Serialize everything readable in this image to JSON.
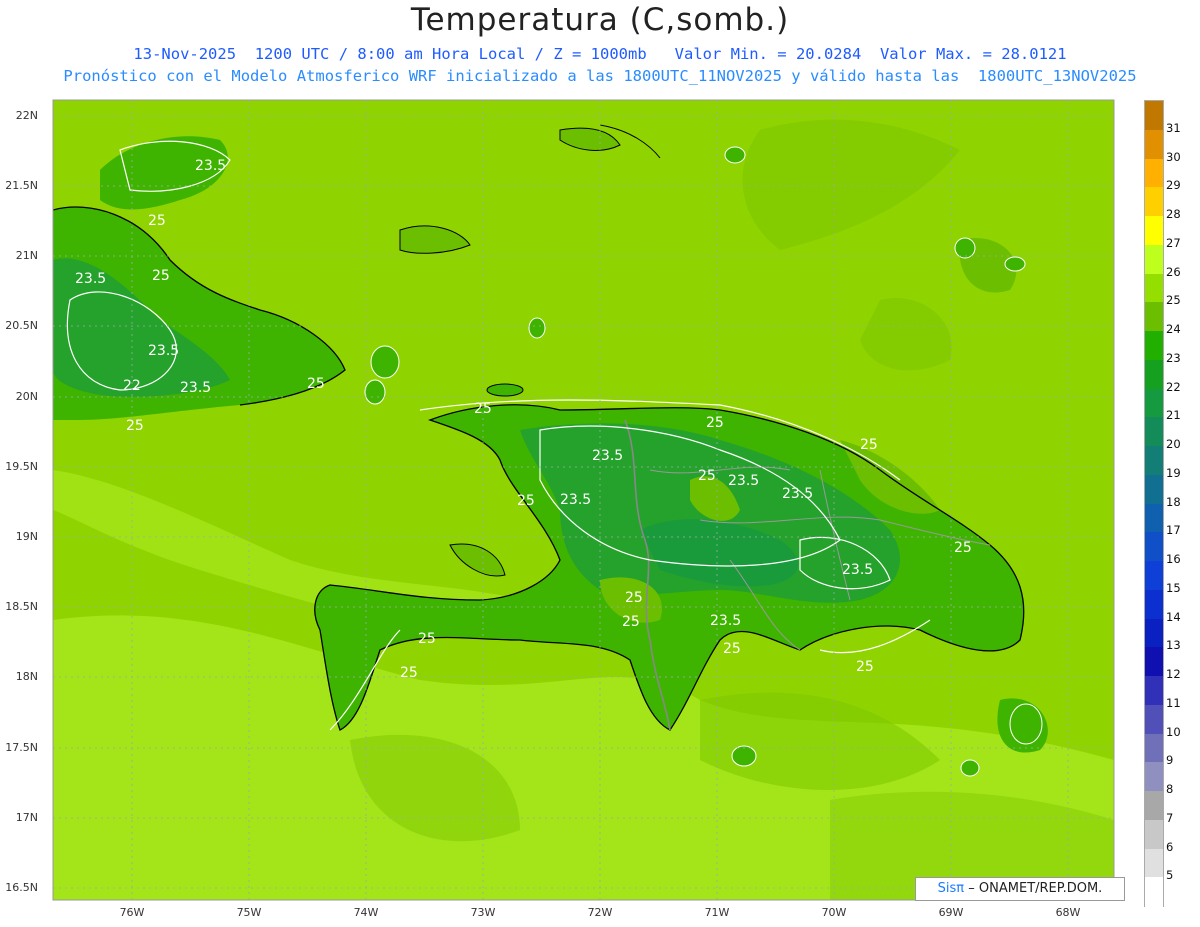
{
  "header": {
    "title": "Temperatura (C,somb.)",
    "line1": "13-Nov-2025  1200 UTC / 8:00 am Hora Local / Z = 1000mb   Valor Min. = 20.0284  Valor Max. = 28.0121",
    "line2": "Pronóstico con el Modelo Atmosferico WRF inicializado a las 1800UTC_11NOV2025 y válido hasta las  1800UTC_13NOV2025"
  },
  "axes": {
    "lat_labels": [
      "22N",
      "21.5N",
      "21N",
      "20.5N",
      "20N",
      "19.5N",
      "19N",
      "18.5N",
      "18N",
      "17.5N",
      "17N",
      "16.5N"
    ],
    "lon_labels": [
      "76W",
      "75W",
      "74W",
      "73W",
      "72W",
      "71W",
      "70W",
      "69W",
      "68W"
    ]
  },
  "contour_labels": [
    "23.5",
    "25",
    "23.5",
    "25",
    "23.5",
    "22",
    "23.5",
    "25",
    "25",
    "25",
    "25",
    "23.5",
    "23.5",
    "25",
    "23.5",
    "23.5",
    "25",
    "25",
    "23.5",
    "25",
    "25",
    "25",
    "25",
    "25",
    "23.5",
    "25"
  ],
  "colorbar": {
    "labels": [
      "31",
      "30",
      "29",
      "28",
      "27",
      "26",
      "25",
      "24",
      "23",
      "22",
      "21",
      "20",
      "19",
      "18",
      "17",
      "16",
      "15",
      "14",
      "13",
      "12",
      "11",
      "10",
      "9",
      "8",
      "7",
      "6",
      "5"
    ],
    "colors": [
      "#c07800",
      "#e09000",
      "#ffb000",
      "#ffd000",
      "#ffff00",
      "#bfff1e",
      "#95df00",
      "#6cbf00",
      "#22b000",
      "#15a020",
      "#169a40",
      "#148c5a",
      "#127e76",
      "#117092",
      "#1060b0",
      "#0f50c8",
      "#0e40d8",
      "#0c30d0",
      "#0a20c0",
      "#1010b0",
      "#3030b8",
      "#5050b8",
      "#7070b8",
      "#9090c0",
      "#a8a8a8",
      "#c8c8c8",
      "#e0e0e0",
      "#ffffff"
    ]
  },
  "credit": {
    "sis": "Sisπ",
    "rest": "– ONAMET/REP.DOM."
  }
}
